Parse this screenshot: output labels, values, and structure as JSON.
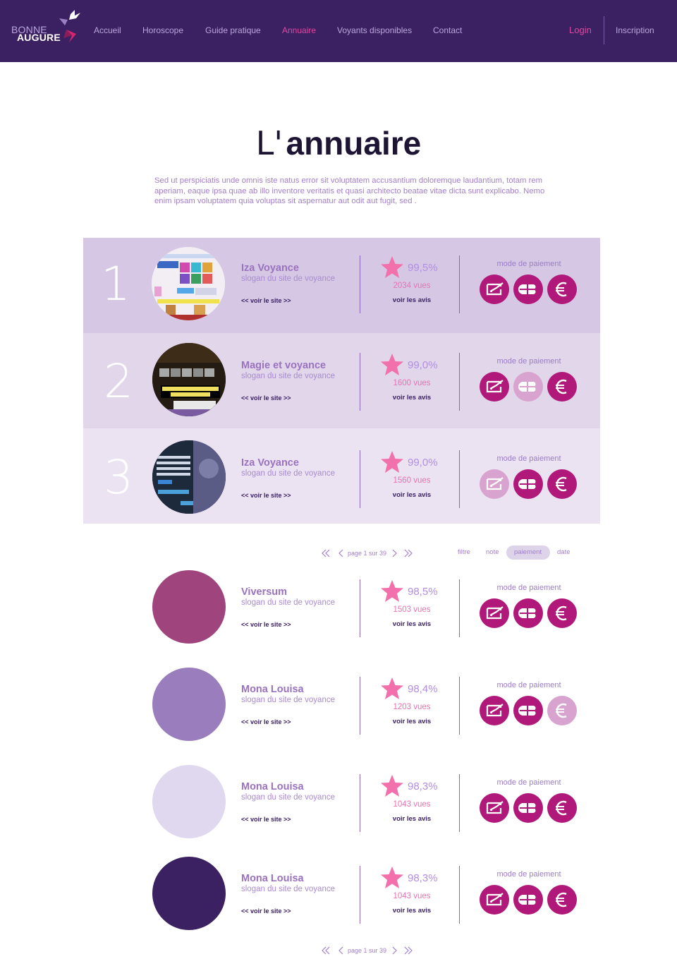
{
  "header": {
    "logo_top": "BONNE",
    "logo_bottom": "AUGURE",
    "nav": [
      "Accueil",
      "Horoscope",
      "Guide pratique",
      "Annuaire",
      "Voyants disponibles",
      "Contact"
    ],
    "active_nav": "Annuaire",
    "login": "Login",
    "inscription": "Inscription"
  },
  "title": {
    "prefix": "L'",
    "main": "annuaire"
  },
  "intro": "Sed ut perspiciatis unde omnis iste natus error sit voluptatem accusantium doloremque laudantium, totam rem aperiam, eaque ipsa quae ab illo inventore veritatis et quasi architecto beatae vitae dicta sunt explicabo. Nemo enim ipsam voluptatem quia voluptas sit aspernatur aut odit aut fugit, sed .",
  "labels": {
    "voir_site": "<< voir le site >>",
    "voir_avis": "voir les avis",
    "mode_paiement": "mode de paiement"
  },
  "top_sites": [
    {
      "rank": "1",
      "name": "Iza Voyance",
      "slogan": "slogan du site de voyance",
      "score": "99,5%",
      "vues": "2034 vues",
      "payments": {
        "cheque": true,
        "cb": true,
        "euro": true
      }
    },
    {
      "rank": "2",
      "name": "Magie et voyance",
      "slogan": "slogan du site de voyance",
      "score": "99,0%",
      "vues": "1600 vues",
      "payments": {
        "cheque": true,
        "cb": false,
        "euro": true
      }
    },
    {
      "rank": "3",
      "name": "Iza Voyance",
      "slogan": "slogan du site de voyance",
      "score": "99,0%",
      "vues": "1560 vues",
      "payments": {
        "cheque": false,
        "cb": true,
        "euro": true
      }
    }
  ],
  "pagination": {
    "text": "page 1 sur 39",
    "filters": [
      "filtre",
      "note",
      "paiement",
      "date"
    ],
    "active_filter": "paiement"
  },
  "other_sites": [
    {
      "name": "Viversum",
      "slogan": "slogan du site de voyance",
      "score": "98,5%",
      "vues": "1503 vues",
      "color": "#a0447e",
      "payments": {
        "cheque": true,
        "cb": true,
        "euro": true
      }
    },
    {
      "name": "Mona Louisa",
      "slogan": "slogan du site de voyance",
      "score": "98,4%",
      "vues": "1203 vues",
      "color": "#9a7dbc",
      "payments": {
        "cheque": true,
        "cb": true,
        "euro": false
      }
    },
    {
      "name": "Mona Louisa",
      "slogan": "slogan du site de voyance",
      "score": "98,3%",
      "vues": "1043 vues",
      "color": "#e0d8ee",
      "payments": {
        "cheque": true,
        "cb": true,
        "euro": true
      }
    },
    {
      "name": "Mona Louisa",
      "slogan": "slogan du site de voyance",
      "score": "98,3%",
      "vues": "1043 vues",
      "color": "#3b2162",
      "payments": {
        "cheque": true,
        "cb": true,
        "euro": true
      }
    }
  ],
  "colors": {
    "header_bg": "#3b2162",
    "accent_pink": "#e0479e",
    "payment": "#b0197a",
    "row1_bg": "#d6c8e4",
    "row2_bg": "#e1d6ea",
    "row3_bg": "#ebe3f1"
  }
}
